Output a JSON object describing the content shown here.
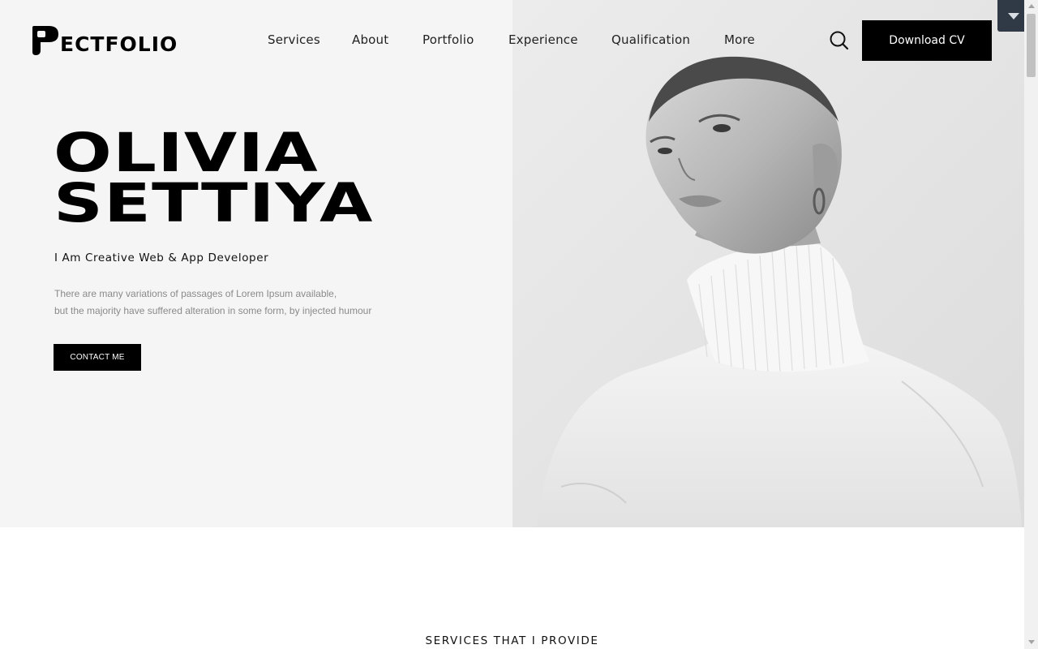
{
  "header": {
    "logo_text": "ECTFOLIO",
    "nav": [
      {
        "label": "Services"
      },
      {
        "label": "About"
      },
      {
        "label": "Portfolio"
      },
      {
        "label": "Experience"
      },
      {
        "label": "Qualification"
      },
      {
        "label": "More"
      }
    ],
    "download_cv_label": "Download CV"
  },
  "hero": {
    "name_line1": "OLIVIA",
    "name_line2": "SETTIYA",
    "subtitle": "I Am Creative Web & App Developer",
    "description_line1": "There are many variations of passages of Lorem Ipsum available,",
    "description_line2": "but the majority have suffered alteration in some form, by injected humour",
    "contact_label": "CONTACT ME"
  },
  "services": {
    "heading": "SERVICES THAT I PROVIDE"
  },
  "icons": {
    "search": "search-icon",
    "scroll_top": "chevron-down-icon",
    "logo": "logo-mark-icon"
  },
  "colors": {
    "primary": "#000000",
    "hero_bg": "#f5f5f5",
    "scroll_top_bg": "#2f3a46"
  }
}
